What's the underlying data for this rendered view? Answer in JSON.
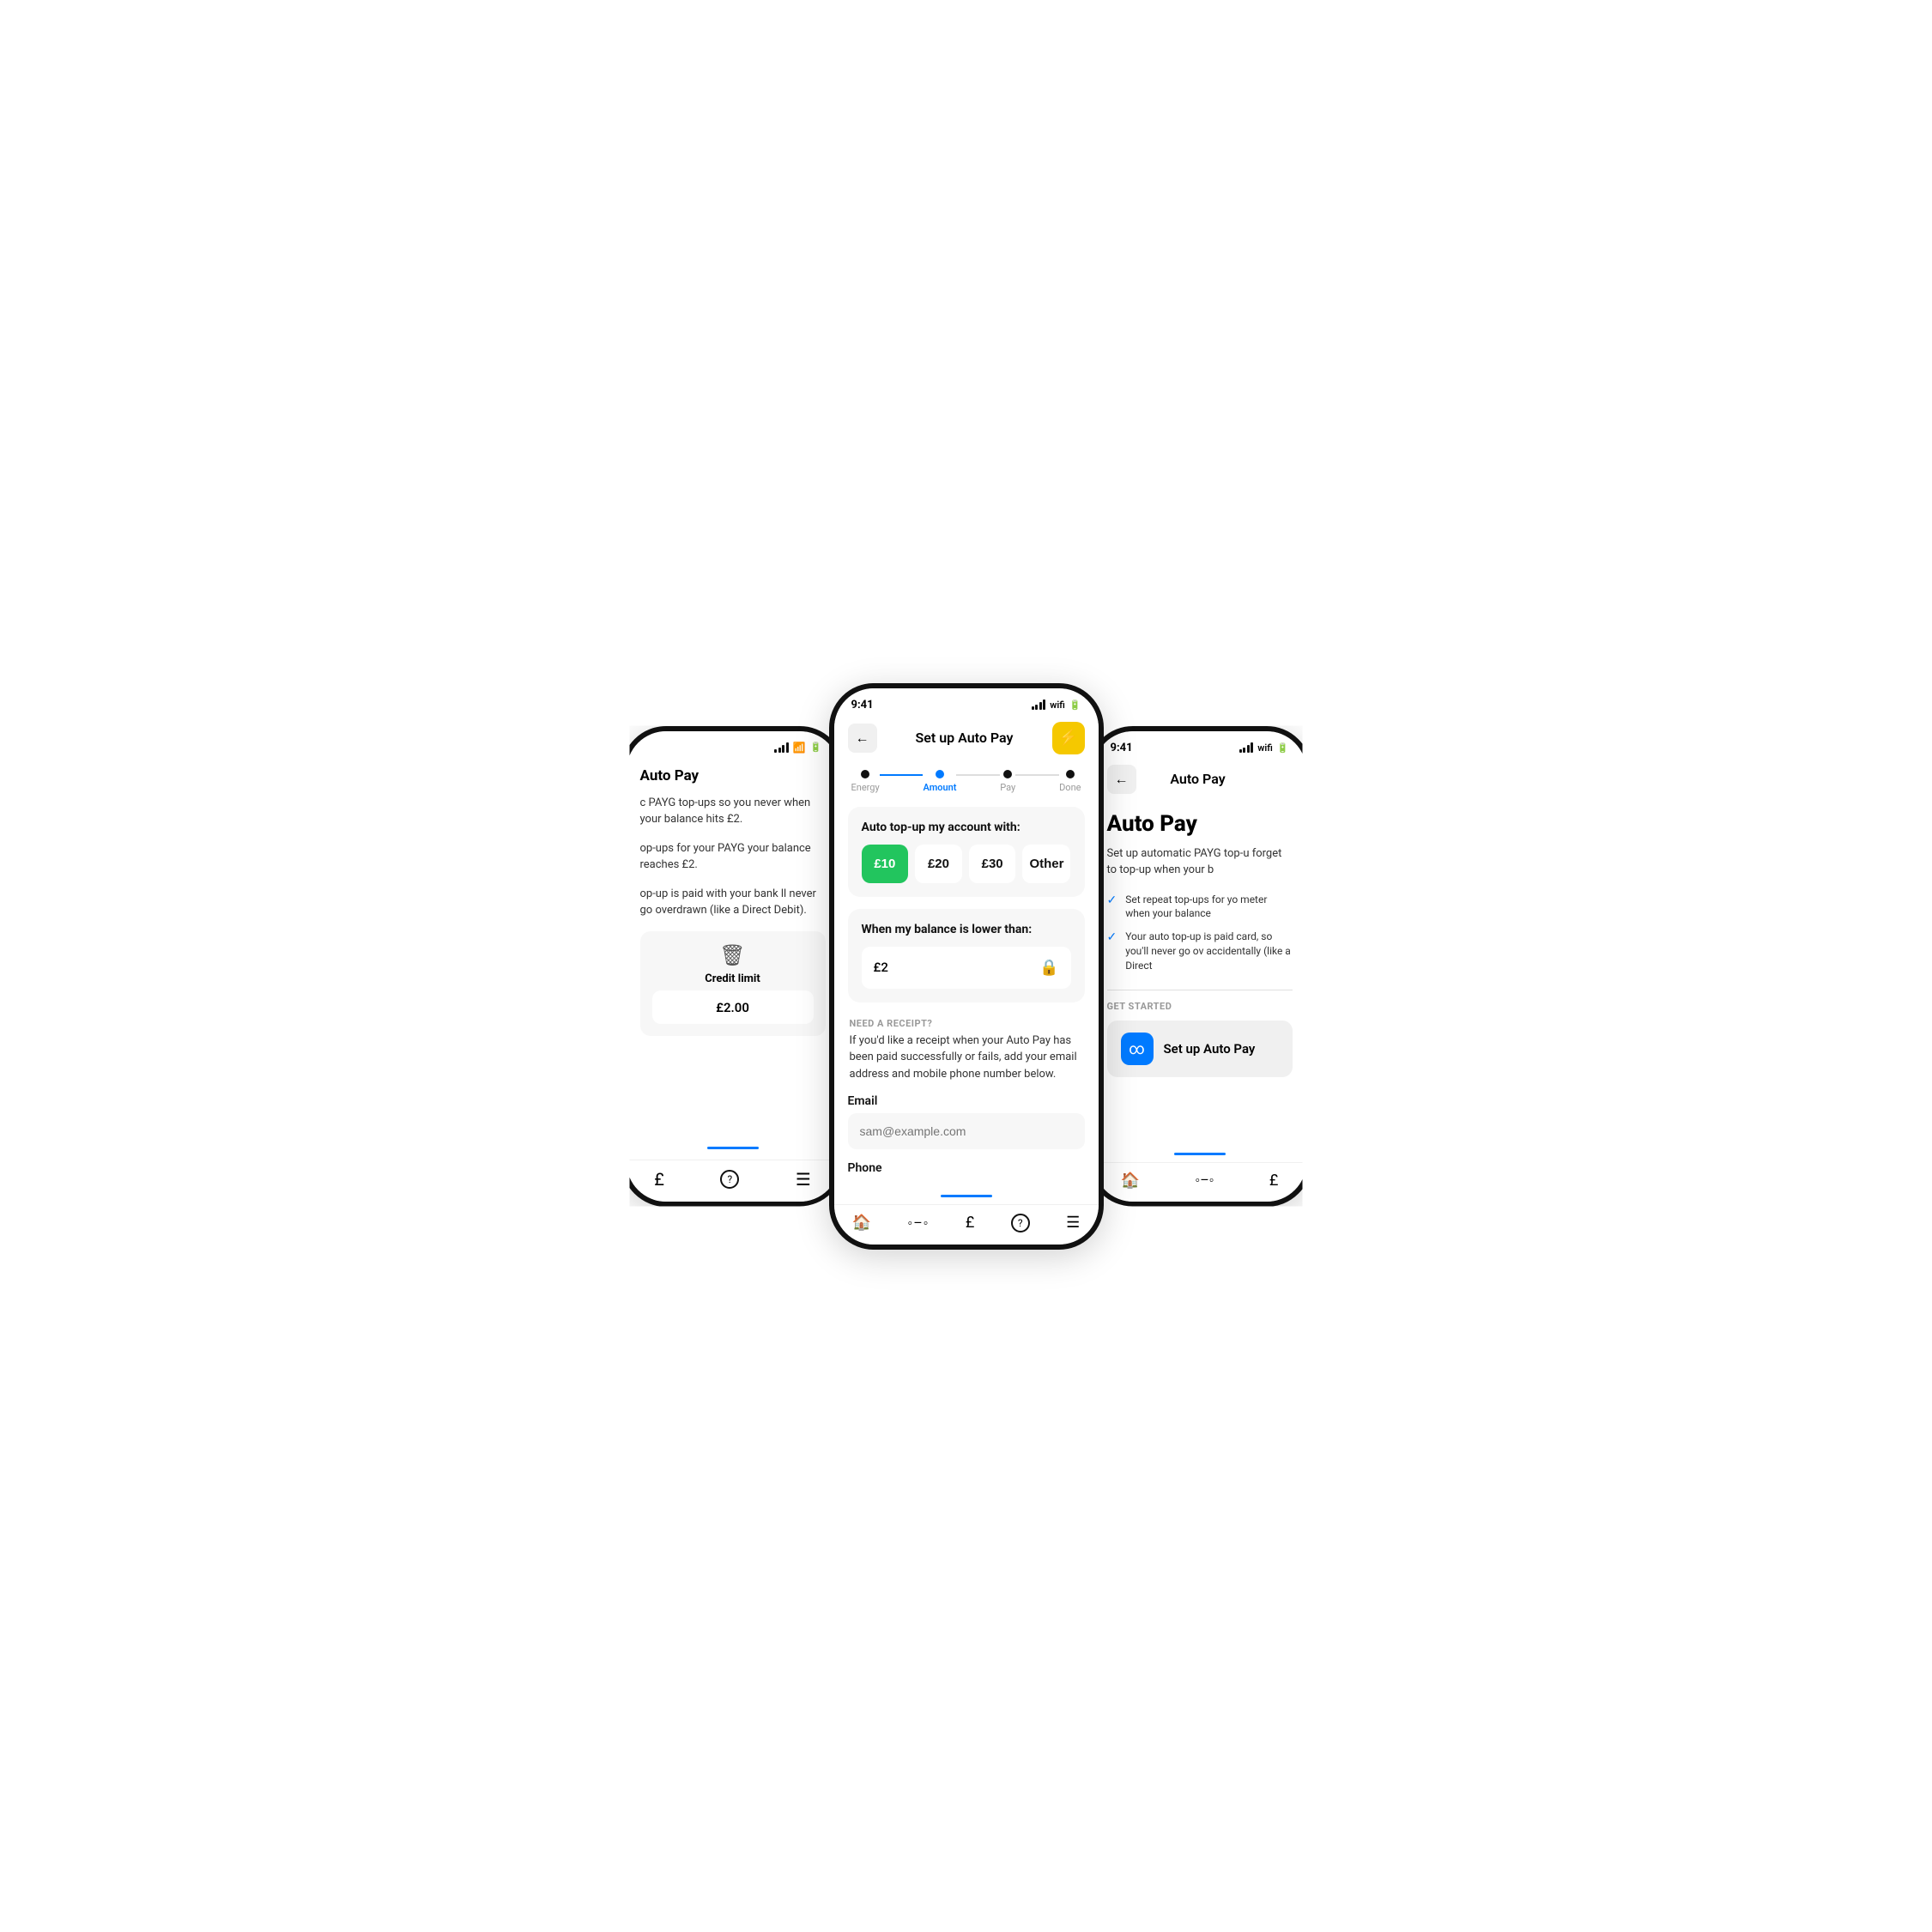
{
  "left_phone": {
    "title": "Auto Pay",
    "description1": "c PAYG top-ups so you never when your balance hits £2.",
    "description2": "op-ups for your PAYG your balance reaches £2.",
    "description3": "op-up is paid with your bank ll never go overdrawn (like a Direct Debit).",
    "credit_label": "Credit limit",
    "credit_value": "£2.00",
    "nav": {
      "items": [
        "£",
        "?",
        "☰"
      ]
    }
  },
  "center_phone": {
    "time": "9:41",
    "nav": {
      "back_label": "←",
      "title": "Set up Auto Pay",
      "action_icon": "⚡"
    },
    "steps": [
      {
        "label": "Energy",
        "state": "done"
      },
      {
        "label": "Amount",
        "state": "active"
      },
      {
        "label": "Pay",
        "state": "pending"
      },
      {
        "label": "Done",
        "state": "pending"
      }
    ],
    "topup_card": {
      "title": "Auto top-up my account with:",
      "amounts": [
        {
          "value": "£10",
          "selected": true
        },
        {
          "value": "£20",
          "selected": false
        },
        {
          "value": "£30",
          "selected": false
        },
        {
          "value": "Other",
          "selected": false
        }
      ]
    },
    "balance_card": {
      "title": "When my balance is lower than:",
      "value": "£2"
    },
    "receipt_section": {
      "label": "NEED A RECEIPT?",
      "text": "If you'd like a receipt when your Auto Pay has been paid successfully or fails, add your email address and mobile phone number below."
    },
    "email_field": {
      "label": "Email",
      "placeholder": "sam@example.com"
    },
    "phone_field": {
      "label": "Phone",
      "placeholder": ""
    },
    "bottom_nav": [
      "🏠",
      "◦◦◦",
      "£",
      "?",
      "☰"
    ]
  },
  "right_phone": {
    "time": "9:41",
    "nav": {
      "back_label": "←",
      "title": "Auto Pay"
    },
    "autopay_title": "Auto Pay",
    "autopay_desc": "Set up automatic PAYG top-u forget to top-up when your b",
    "checks": [
      "Set repeat top-ups for yo meter when your balance",
      "Your auto top-up is paid card, so you'll never go ov accidentally (like a Direct"
    ],
    "get_started_label": "GET STARTED",
    "setup_button_label": "Set up Auto Pay",
    "bottom_nav": [
      "🏠",
      "◦◦◦",
      "£"
    ]
  }
}
